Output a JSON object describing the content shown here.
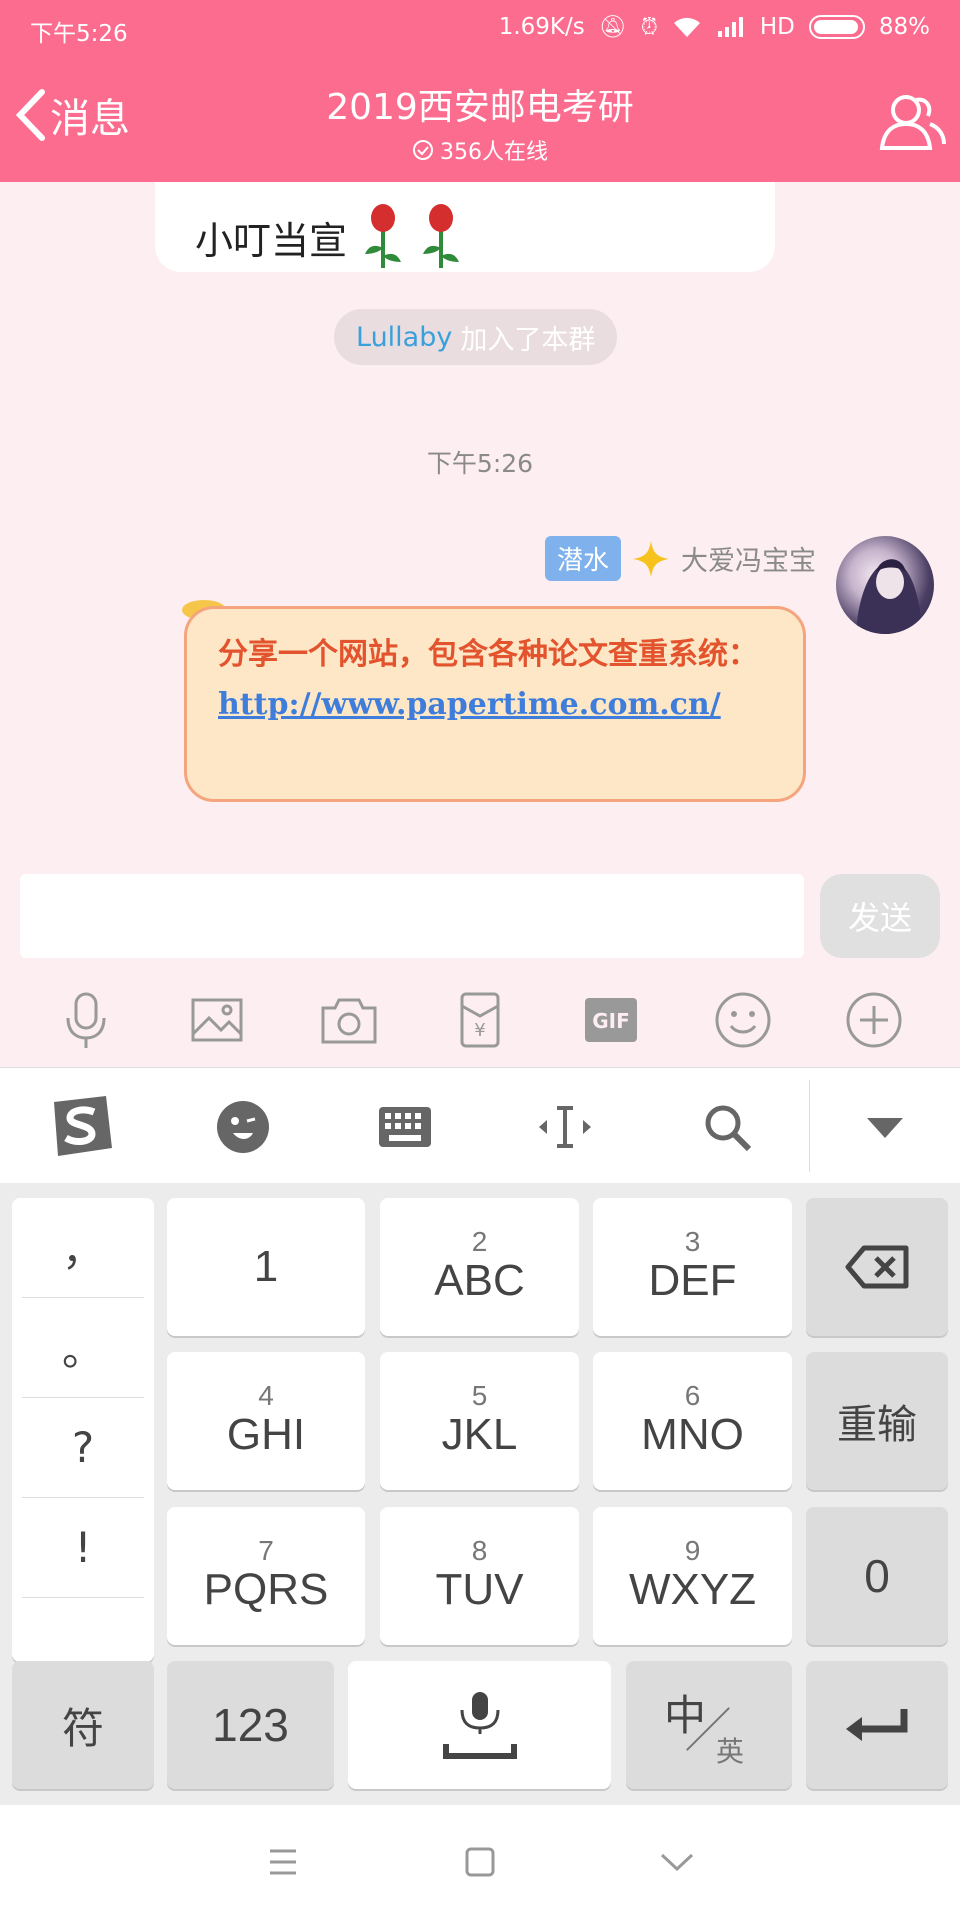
{
  "status": {
    "time": "下午5:26",
    "net_speed": "1.69K/s",
    "network": "HD",
    "battery": "88%"
  },
  "header": {
    "back_label": "消息",
    "title": "2019西安邮电考研",
    "online": "356人在线"
  },
  "chat": {
    "prev_message": "小叮当宣",
    "system_notice": {
      "who": "Lullaby",
      "action": "加入了本群"
    },
    "timestamp": "下午5:26",
    "message": {
      "badge": "潜水",
      "sender": "大爱冯宝宝",
      "text": "分享一个网站，包含各种论文查重系统：",
      "link": "http://www.papertime.com.cn/"
    }
  },
  "input": {
    "placeholder": "",
    "send_label": "发送"
  },
  "toolbar": {
    "icons": [
      "mic-icon",
      "image-icon",
      "camera-icon",
      "red-packet-icon",
      "gif-icon",
      "emoji-icon",
      "plus-icon"
    ]
  },
  "keyboard": {
    "top_icons": [
      "sogou-logo-icon",
      "emoji-face-icon",
      "keyboard-icon",
      "cursor-move-icon",
      "search-icon",
      "collapse-icon"
    ],
    "punct": [
      "，",
      "。",
      "?",
      "!"
    ],
    "keys": {
      "k1": {
        "num": "",
        "letters": "1"
      },
      "k2": {
        "num": "2",
        "letters": "ABC"
      },
      "k3": {
        "num": "3",
        "letters": "DEF"
      },
      "k4": {
        "num": "4",
        "letters": "GHI"
      },
      "k5": {
        "num": "5",
        "letters": "JKL"
      },
      "k6": {
        "num": "6",
        "letters": "MNO"
      },
      "k7": {
        "num": "7",
        "letters": "PQRS"
      },
      "k8": {
        "num": "8",
        "letters": "TUV"
      },
      "k9": {
        "num": "9",
        "letters": "WXYZ"
      }
    },
    "reenter": "重输",
    "zero": "0",
    "symbol": "符",
    "num_mode": "123",
    "lang_main": "中",
    "lang_sub": "英"
  },
  "colors": {
    "header": "#fb6c8f",
    "chat_bg": "#fdeef1",
    "link": "#3e7ddb",
    "message_text": "#e3532d"
  }
}
